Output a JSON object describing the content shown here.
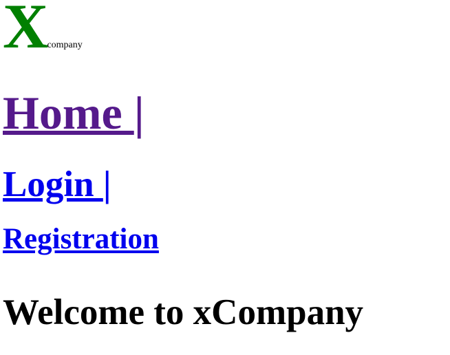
{
  "logo": {
    "letter": "X",
    "subtext": "company",
    "letter_color": "#008000"
  },
  "nav": {
    "home_label": "Home ",
    "home_separator": "|",
    "login_label": "Login ",
    "login_separator": "|",
    "registration_label": "Registration",
    "visited_link_color": "#551a8b",
    "link_color": "#0000ee"
  },
  "main": {
    "heading": "Welcome to xCompany"
  }
}
